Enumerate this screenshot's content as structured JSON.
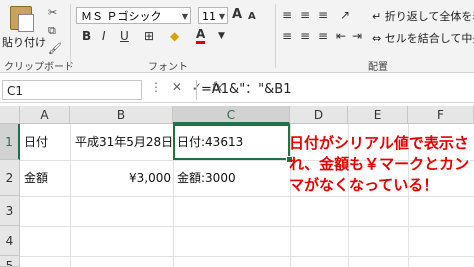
{
  "ribbon": {
    "paste_label": "貼り付け",
    "clipboard_label": "クリップボード",
    "font_label": "フォント",
    "font_name": "ＭＳ Ｐゴシック",
    "font_size": "11",
    "bold": "B",
    "italic": "I",
    "underline": "U",
    "grow_font": "A",
    "shrink_font": "A",
    "font_color_btn": "A",
    "wrap_text": "折り返して全体を表示",
    "merge_center": "セルを結合して中央揃",
    "alignment_label": "配置"
  },
  "formula_bar": {
    "name_box": "C1",
    "cancel": "✕",
    "enter": "✓",
    "fx": "fx",
    "formula": "=A1&\"：\"&B1"
  },
  "sheet": {
    "columns": [
      "A",
      "B",
      "C",
      "D",
      "E",
      "F"
    ],
    "rows": [
      "1",
      "2",
      "3",
      "4",
      "5"
    ],
    "cells": {
      "A1": "日付",
      "B1": "平成31年5月28日",
      "C1": "日付:43613",
      "A2": "金額",
      "B2": "¥3,000",
      "C2": "金額:3000"
    }
  },
  "annotation": "日付がシリアル値で表示され、金額も￥マークとカンマがなくなっている！",
  "colors": {
    "accent": "#217346",
    "annotation": "#e60000"
  }
}
